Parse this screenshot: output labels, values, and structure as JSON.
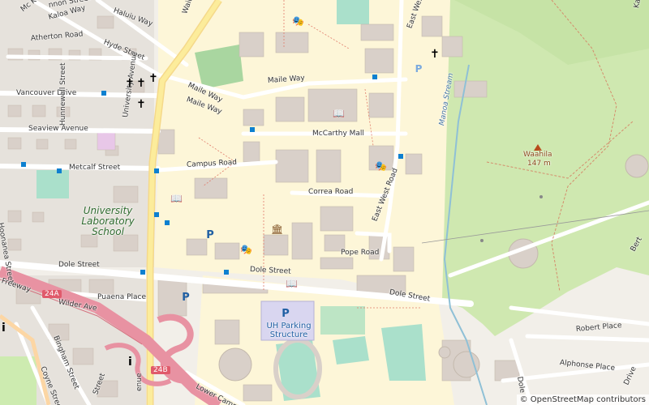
{
  "map": {
    "labels": {
      "kaloa_way": "Kaloa Way",
      "mc_k": "Mc K",
      "nnon_street": "nnon Street",
      "haluiu_way": "Haluiu Way",
      "waiu_st": "Waiu St",
      "atherton_road": "Atherton Road",
      "hyde_street": "Hyde Street",
      "vancouver_drive": "Vancouver Drive",
      "hunnewell_street": "Hunnewell Street",
      "seaview_avenue": "Seaview Avenue",
      "metcalf_street": "Metcalf Street",
      "university_avenue": "University Avenue",
      "university_avenue_lower": "enue",
      "maile_way_1": "Maile Way",
      "maile_way_2": "Maile Way",
      "maile_way_3": "Maile Way",
      "mccarthy_mall": "McCarthy Mall",
      "campus_road": "Campus Road",
      "correa_road": "Correa Road",
      "east_west_road": "East West Road",
      "east_west_road_upper": "East West Ro",
      "pope_road": "Pope Road",
      "dole_street_w": "Dole Street",
      "dole_street_c": "Dole Street",
      "dole_street_e": "Dole Street",
      "dole_street_se": "Dole",
      "hoonanea_street": "Hoonanea Street",
      "university_lab_school": "University Laboratory School",
      "freeway": "Freeway",
      "wilder_avenue": "Wilder Ave",
      "puaena_place": "Puaena Place",
      "bingham_street": "Bingham Street",
      "coyne_street": "Coyne Street",
      "lower_campus": "Lower Campus Ro",
      "uh_parking_structure": "UH Parking Structure",
      "manoa_stream": "Manoa Stream",
      "waahila": "Waahila",
      "waahila_elev": "147 m",
      "robert_place": "Robert Place",
      "alphonse_place": "Alphonse Place",
      "berta": "Bert",
      "drive": "Drive",
      "kai": "Kai",
      "street_fragment": "Street",
      "parking_letter": "P"
    },
    "shields": {
      "h1_24a": "24A",
      "h1_24b": "24B"
    },
    "icons": {
      "theatre": "theatre-icon",
      "library": "library-icon",
      "museum": "museum-icon",
      "church": "church-icon",
      "info": "info-icon",
      "parking": "parking-icon",
      "peak": "peak-icon"
    },
    "colors": {
      "background": "#f2efe9",
      "campus": "#fdf6d8",
      "building": "#d9d0c9",
      "building_outline": "#c4b9ad",
      "park": "#cdebb0",
      "forest": "#c6e3a6",
      "pitch": "#aae0cb",
      "water": "#aad3df",
      "road": "#ffffff",
      "primary": "#fcd6a4",
      "motorway": "#e892a2",
      "bus_stop": "#0d80d0",
      "parking": "#7aa9de"
    },
    "attribution": "© OpenStreetMap contributors"
  }
}
